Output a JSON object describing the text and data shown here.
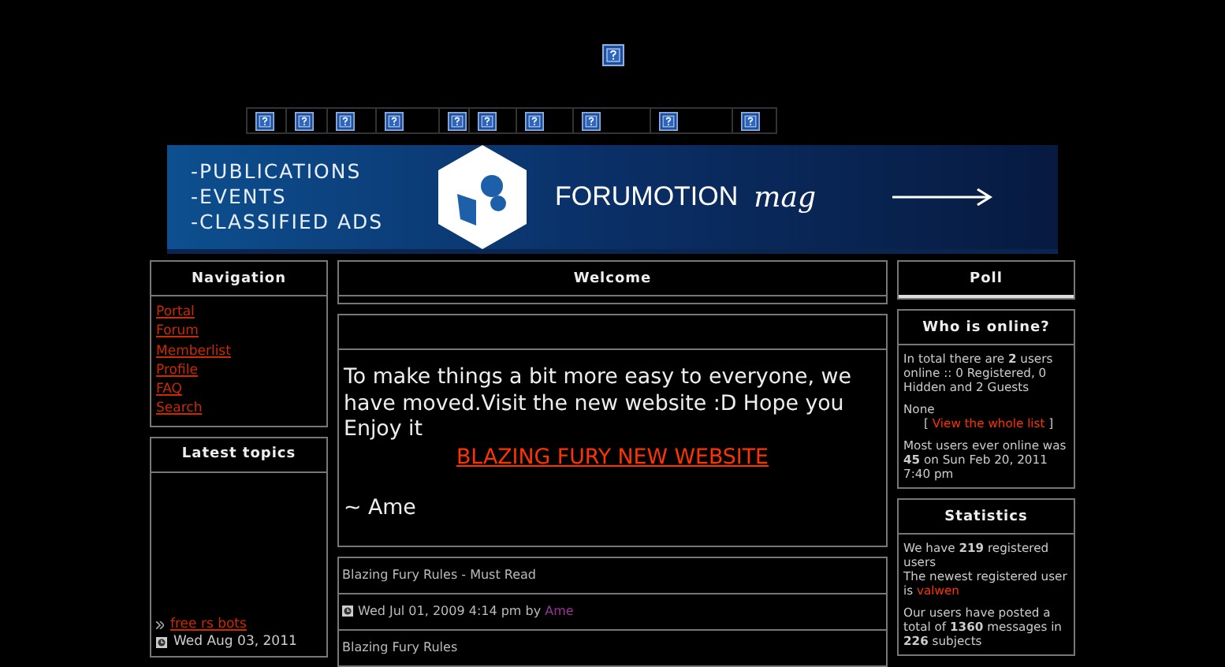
{
  "banner": {
    "lines": [
      "-PUBLICATIONS",
      "-EVENTS",
      "-CLASSIFIED ADS"
    ],
    "brand": "**FORUM**OTION",
    "tagline": "mag"
  },
  "navigation": {
    "title": "Navigation",
    "items": [
      "Portal",
      "Forum",
      "Memberlist",
      "Profile",
      "FAQ",
      "Search"
    ]
  },
  "latest_topics": {
    "title": "Latest topics",
    "items": [
      {
        "title": "free rs bots",
        "date": "Wed Aug 03, 2011"
      }
    ]
  },
  "welcome": {
    "title": "Welcome"
  },
  "announcement": {
    "text": "To make things a bit more easy to everyone, we have moved.Visit the new website :D Hope you Enjoy it",
    "link": "BLAZING FURY NEW WEBSITE",
    "signature": "~ Ame"
  },
  "post": {
    "title": "Blazing Fury Rules - Must Read",
    "meta": "Wed Jul 01, 2009 4:14 pm by",
    "author": "Ame",
    "body": "Blazing Fury Rules"
  },
  "poll": {
    "title": "Poll"
  },
  "who_is_online": {
    "title": "Who is online?",
    "summary": "In total there are **2** users online :: 0 Registered, 0 Hidden and 2 Guests",
    "users": "None",
    "list_open": "[",
    "list_link": "View the whole list",
    "list_close": "]",
    "record": "Most users ever online was **45** on Sun Feb 20, 2011 7:40 pm"
  },
  "statistics": {
    "title": "Statistics",
    "members": "We have **219** registered users",
    "newest": "The newest registered user is",
    "newest_user": "valwen",
    "posts": "Our users have posted a total of **1360** messages in **226** subjects"
  }
}
